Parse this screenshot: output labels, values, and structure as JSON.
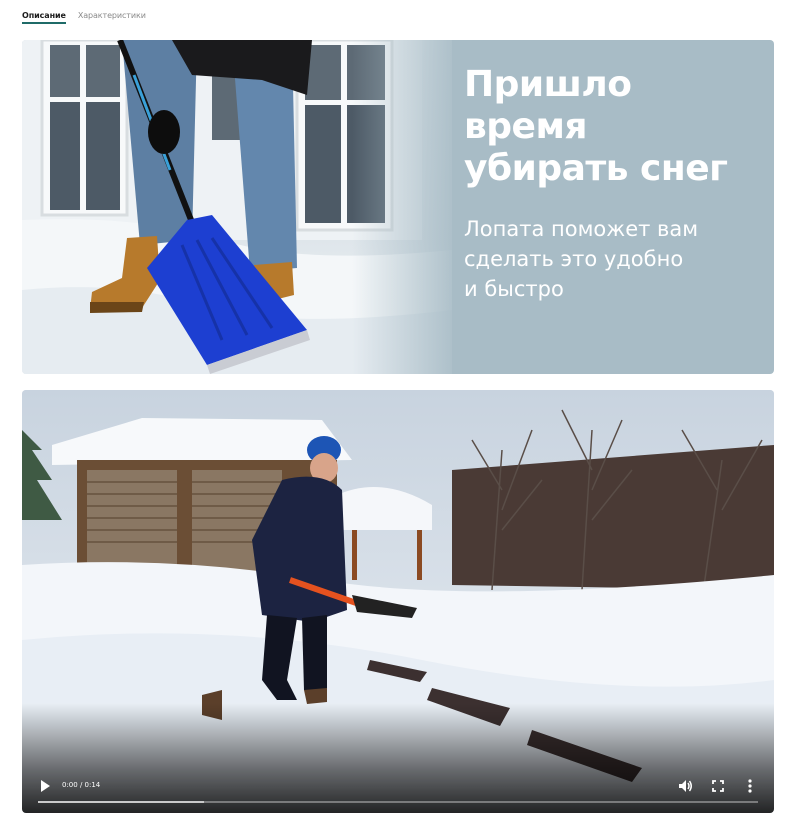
{
  "tabs": [
    {
      "label": "Описание",
      "active": true
    },
    {
      "label": "Характеристики",
      "active": false
    }
  ],
  "banner": {
    "title_line1": "Пришло время",
    "title_line2": "убирать снег",
    "subtitle_line1": "Лопата поможет вам",
    "subtitle_line2": "сделать это удобно",
    "subtitle_line3": "и быстро",
    "background_color": "#a8bcc6",
    "shovel_color": "#1d3fd1"
  },
  "video": {
    "time_display": "0:00 / 0:14",
    "buffered_fraction": 0.23,
    "played_fraction": 0.0,
    "controls": {
      "play_icon": "play-icon",
      "volume_icon": "volume-icon",
      "fullscreen_icon": "fullscreen-icon",
      "menu_icon": "more-vert-icon"
    }
  }
}
